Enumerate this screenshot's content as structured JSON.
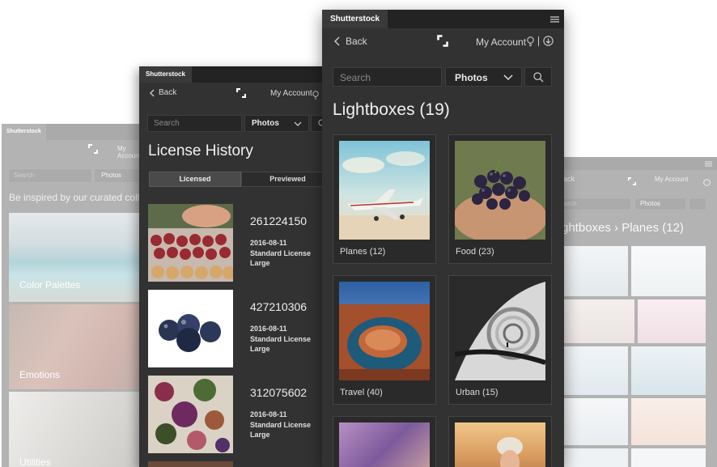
{
  "app": {
    "tab_label": "Shutterstock"
  },
  "colors": {
    "panel_bg": "#323232",
    "tab_bg": "#232323",
    "field_bg": "#262626",
    "text": "#e6e6e6"
  },
  "nav": {
    "back_label": "Back",
    "account_label": "My Account"
  },
  "search": {
    "placeholder": "Search",
    "filter_value": "Photos"
  },
  "left_panel": {
    "tagline": "Be inspired by our curated coll",
    "categories": [
      {
        "label": "Color Palettes"
      },
      {
        "label": "Emotions"
      },
      {
        "label": "Utilities"
      }
    ]
  },
  "middle_panel": {
    "title": "License History",
    "tabs": [
      {
        "label": "Licensed"
      },
      {
        "label": "Previewed"
      }
    ],
    "licenses": [
      {
        "id": "261224150",
        "date": "2016-08-11",
        "type": "Standard License",
        "size": "Large"
      },
      {
        "id": "427210306",
        "date": "2016-08-11",
        "type": "Standard License",
        "size": "Large"
      },
      {
        "id": "312075602",
        "date": "2016-08-11",
        "type": "Standard License",
        "size": "Large"
      }
    ]
  },
  "front_panel": {
    "title": "Lightboxes (19)",
    "lightboxes": [
      {
        "label": "Planes (12)"
      },
      {
        "label": "Food (23)"
      },
      {
        "label": "Travel (40)"
      },
      {
        "label": "Urban (15)"
      }
    ]
  },
  "right_panel": {
    "back_fragment": "ack",
    "search_fragment": "arch",
    "breadcrumb": "ghtboxes › Planes (12)"
  },
  "icons": [
    "chevron-left-icon",
    "shutterstock-logo-icon",
    "lightbulb-icon",
    "download-icon",
    "chevron-down-icon",
    "search-icon",
    "menu-icon"
  ]
}
